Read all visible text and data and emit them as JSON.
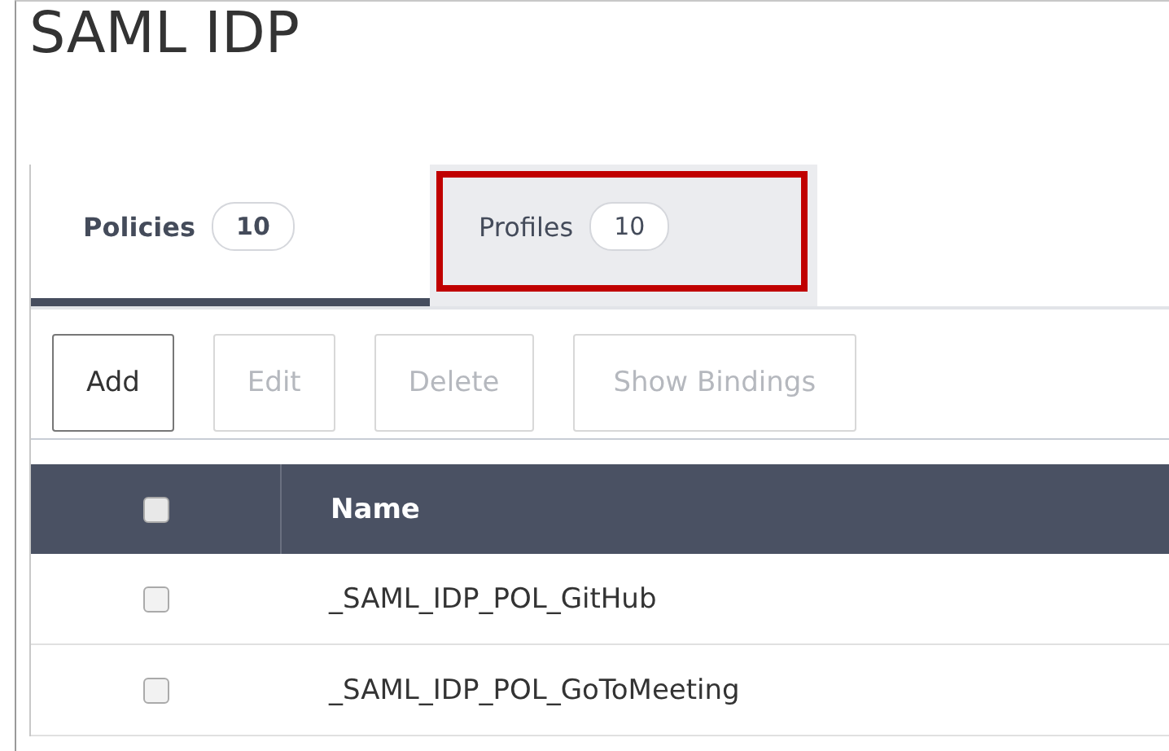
{
  "title": "SAML IDP",
  "tabs": [
    {
      "label": "Policies",
      "count": "10",
      "selected": true,
      "highlighted": false
    },
    {
      "label": "Profiles",
      "count": "10",
      "selected": false,
      "highlighted": true
    }
  ],
  "buttons": [
    {
      "label": "Add",
      "disabled": false
    },
    {
      "label": "Edit",
      "disabled": true
    },
    {
      "label": "Delete",
      "disabled": true
    },
    {
      "label": "Show Bindings",
      "disabled": true
    }
  ],
  "table": {
    "columns": [
      "Name"
    ],
    "select_all_checked": false,
    "rows": [
      {
        "name": "_SAML_IDP_POL_GitHub",
        "checked": false
      },
      {
        "name": "_SAML_IDP_POL_GoToMeeting",
        "checked": false
      }
    ]
  }
}
